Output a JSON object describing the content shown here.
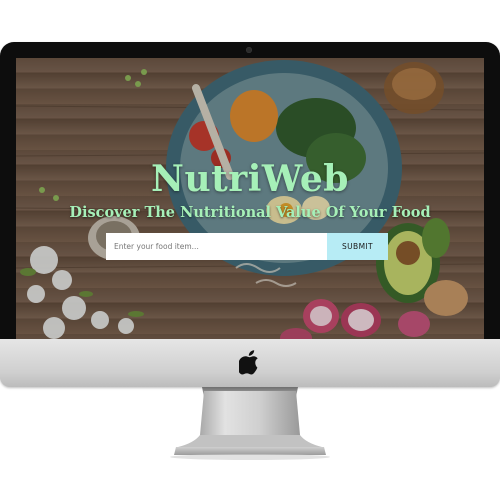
{
  "site": {
    "brand": "NutriWeb",
    "tagline": "Discover The Nutritional Value Of Your Food"
  },
  "search": {
    "placeholder": "Enter your food item...",
    "value": "",
    "submit_label": "SUBMIT"
  },
  "colors": {
    "brand_green": "#a6f0b8",
    "submit_bg": "#b7ecf5",
    "bezel": "#0d0d0d",
    "aluminum": "#d0d0d0"
  },
  "icons": {
    "hardware_logo": "apple-logo-icon",
    "camera": "camera-icon"
  }
}
